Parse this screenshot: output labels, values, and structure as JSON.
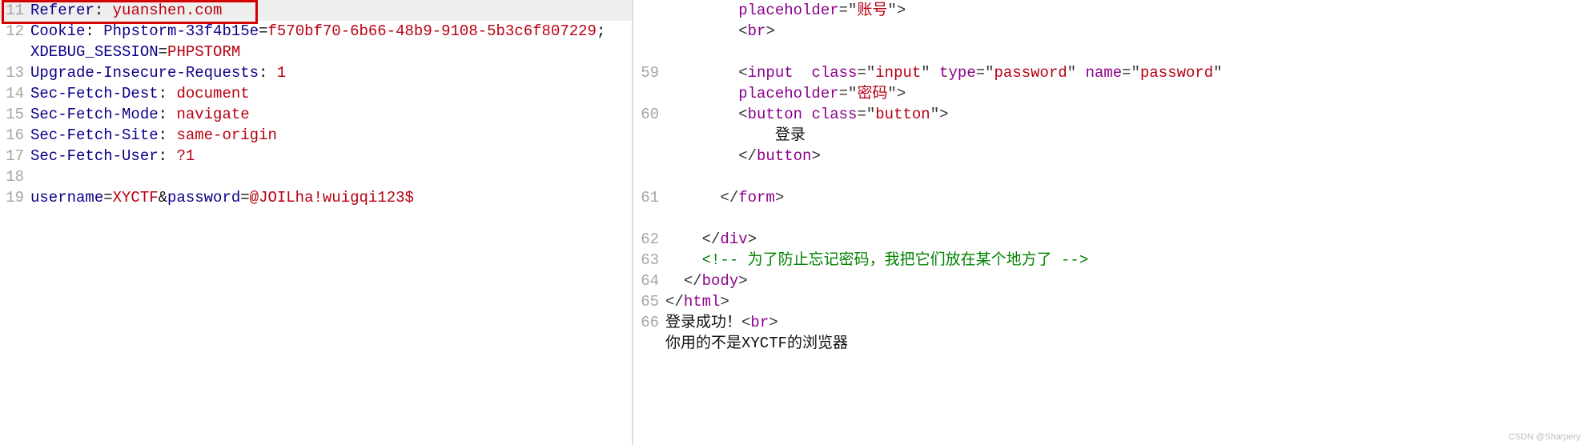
{
  "left": {
    "lines": [
      {
        "n": 11,
        "hl": true,
        "segments": [
          {
            "t": "Referer",
            "c": "c-key"
          },
          {
            "t": ": ",
            "c": "c-plain"
          },
          {
            "t": "yuanshen.com",
            "c": "c-val"
          }
        ]
      },
      {
        "n": 12,
        "segments": [
          {
            "t": "Cookie",
            "c": "c-key"
          },
          {
            "t": ": ",
            "c": "c-plain"
          },
          {
            "t": "Phpstorm-33f4b15e",
            "c": "c-key"
          },
          {
            "t": "=",
            "c": "c-plain"
          },
          {
            "t": "f570bf70-6b66-48b9-9108-5b3c6f807229",
            "c": "c-val"
          },
          {
            "t": "; ",
            "c": "c-plain"
          }
        ]
      },
      {
        "n": "",
        "segments": [
          {
            "t": "XDEBUG_SESSION",
            "c": "c-key"
          },
          {
            "t": "=",
            "c": "c-plain"
          },
          {
            "t": "PHPSTORM",
            "c": "c-val"
          }
        ]
      },
      {
        "n": 13,
        "segments": [
          {
            "t": "Upgrade-Insecure-Requests",
            "c": "c-key"
          },
          {
            "t": ": ",
            "c": "c-plain"
          },
          {
            "t": "1",
            "c": "c-val"
          }
        ]
      },
      {
        "n": 14,
        "segments": [
          {
            "t": "Sec-Fetch-Dest",
            "c": "c-key"
          },
          {
            "t": ": ",
            "c": "c-plain"
          },
          {
            "t": "document",
            "c": "c-val"
          }
        ]
      },
      {
        "n": 15,
        "segments": [
          {
            "t": "Sec-Fetch-Mode",
            "c": "c-key"
          },
          {
            "t": ": ",
            "c": "c-plain"
          },
          {
            "t": "navigate",
            "c": "c-val"
          }
        ]
      },
      {
        "n": 16,
        "segments": [
          {
            "t": "Sec-Fetch-Site",
            "c": "c-key"
          },
          {
            "t": ": ",
            "c": "c-plain"
          },
          {
            "t": "same-origin",
            "c": "c-val"
          }
        ]
      },
      {
        "n": 17,
        "segments": [
          {
            "t": "Sec-Fetch-User",
            "c": "c-key"
          },
          {
            "t": ": ",
            "c": "c-plain"
          },
          {
            "t": "?1",
            "c": "c-val"
          }
        ]
      },
      {
        "n": 18,
        "segments": [
          {
            "t": "",
            "c": "c-plain"
          }
        ]
      },
      {
        "n": 19,
        "segments": [
          {
            "t": "username",
            "c": "c-key"
          },
          {
            "t": "=",
            "c": "c-plain"
          },
          {
            "t": "XYCTF",
            "c": "c-val"
          },
          {
            "t": "&",
            "c": "c-plain"
          },
          {
            "t": "password",
            "c": "c-key"
          },
          {
            "t": "=",
            "c": "c-plain"
          },
          {
            "t": "@JOILha!wuigqi123$",
            "c": "c-val"
          }
        ]
      }
    ]
  },
  "right": {
    "lines": [
      {
        "n": "",
        "indent": 3,
        "segments": [
          {
            "t": "placeholder",
            "c": "c-attr"
          },
          {
            "t": "=\"",
            "c": "c-pun"
          },
          {
            "t": "账号",
            "c": "c-str"
          },
          {
            "t": "\">",
            "c": "c-pun"
          }
        ]
      },
      {
        "n": "",
        "indent": 3,
        "segments": [
          {
            "t": "<",
            "c": "c-pun"
          },
          {
            "t": "br",
            "c": "c-tag"
          },
          {
            "t": ">",
            "c": "c-pun"
          }
        ]
      },
      {
        "n": "",
        "indent": 3,
        "segments": [
          {
            "t": " ",
            "c": "c-plain"
          }
        ]
      },
      {
        "n": 59,
        "indent": 3,
        "segments": [
          {
            "t": "<",
            "c": "c-pun"
          },
          {
            "t": "input",
            "c": "c-tag"
          },
          {
            "t": "  ",
            "c": "c-plain"
          },
          {
            "t": "class",
            "c": "c-attr"
          },
          {
            "t": "=\"",
            "c": "c-pun"
          },
          {
            "t": "input",
            "c": "c-str"
          },
          {
            "t": "\" ",
            "c": "c-pun"
          },
          {
            "t": "type",
            "c": "c-attr"
          },
          {
            "t": "=\"",
            "c": "c-pun"
          },
          {
            "t": "password",
            "c": "c-str"
          },
          {
            "t": "\" ",
            "c": "c-pun"
          },
          {
            "t": "name",
            "c": "c-attr"
          },
          {
            "t": "=\"",
            "c": "c-pun"
          },
          {
            "t": "password",
            "c": "c-str"
          },
          {
            "t": "\"",
            "c": "c-pun"
          }
        ]
      },
      {
        "n": "",
        "indent": 3,
        "segments": [
          {
            "t": "placeholder",
            "c": "c-attr"
          },
          {
            "t": "=\"",
            "c": "c-pun"
          },
          {
            "t": "密码",
            "c": "c-str"
          },
          {
            "t": "\">",
            "c": "c-pun"
          }
        ]
      },
      {
        "n": 60,
        "indent": 3,
        "segments": [
          {
            "t": "<",
            "c": "c-pun"
          },
          {
            "t": "button",
            "c": "c-tag"
          },
          {
            "t": " ",
            "c": "c-plain"
          },
          {
            "t": "class",
            "c": "c-attr"
          },
          {
            "t": "=\"",
            "c": "c-pun"
          },
          {
            "t": "button",
            "c": "c-str"
          },
          {
            "t": "\">",
            "c": "c-pun"
          }
        ]
      },
      {
        "n": "",
        "indent": 3,
        "segments": [
          {
            "t": "    登录",
            "c": "c-plain"
          }
        ]
      },
      {
        "n": "",
        "indent": 3,
        "segments": [
          {
            "t": "</",
            "c": "c-pun"
          },
          {
            "t": "button",
            "c": "c-tag"
          },
          {
            "t": ">",
            "c": "c-pun"
          }
        ]
      },
      {
        "n": "",
        "indent": 3,
        "segments": [
          {
            "t": " ",
            "c": "c-plain"
          }
        ]
      },
      {
        "n": 61,
        "indent": 2,
        "segments": [
          {
            "t": "  </",
            "c": "c-pun"
          },
          {
            "t": "form",
            "c": "c-tag"
          },
          {
            "t": ">",
            "c": "c-pun"
          }
        ]
      },
      {
        "n": "",
        "indent": 2,
        "segments": [
          {
            "t": " ",
            "c": "c-plain"
          }
        ]
      },
      {
        "n": 62,
        "indent": 2,
        "segments": [
          {
            "t": "</",
            "c": "c-pun"
          },
          {
            "t": "div",
            "c": "c-tag"
          },
          {
            "t": ">",
            "c": "c-pun"
          }
        ]
      },
      {
        "n": 63,
        "indent": 2,
        "segments": [
          {
            "t": "<!-- 为了防止忘记密码，我把它们放在某个地方了 -->",
            "c": "c-comment"
          }
        ]
      },
      {
        "n": 64,
        "indent": 1,
        "segments": [
          {
            "t": "</",
            "c": "c-pun"
          },
          {
            "t": "body",
            "c": "c-tag"
          },
          {
            "t": ">",
            "c": "c-pun"
          }
        ]
      },
      {
        "n": 65,
        "indent": 0,
        "segments": [
          {
            "t": "</",
            "c": "c-pun"
          },
          {
            "t": "html",
            "c": "c-tag"
          },
          {
            "t": ">",
            "c": "c-pun"
          }
        ]
      },
      {
        "n": 66,
        "indent": 0,
        "segments": [
          {
            "t": "登录成功！",
            "c": "c-plain"
          },
          {
            "t": "<",
            "c": "c-pun"
          },
          {
            "t": "br",
            "c": "c-tag"
          },
          {
            "t": ">",
            "c": "c-pun"
          }
        ]
      },
      {
        "n": "",
        "indent": 0,
        "segments": [
          {
            "t": "你用的不是XYCTF的浏览器",
            "c": "c-plain"
          }
        ]
      }
    ]
  },
  "watermark": "CSDN @Sharpery"
}
